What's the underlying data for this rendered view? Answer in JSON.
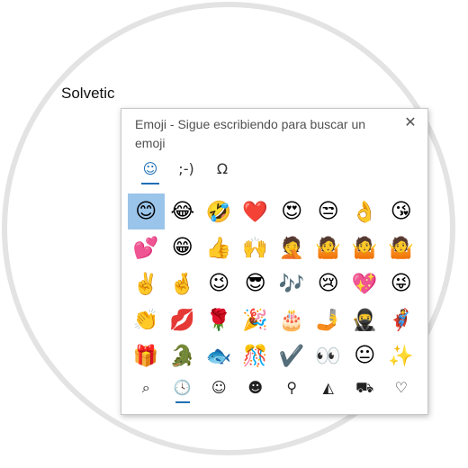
{
  "document": {
    "text": "Solvetic"
  },
  "emoji_panel": {
    "title": "Emoji - Sigue escribiendo para buscar un emoji",
    "close_glyph": "✕",
    "tabs": [
      {
        "name": "emoji-tab",
        "glyph": "☺",
        "active": true
      },
      {
        "name": "kaomoji-tab",
        "glyph": ";-)",
        "active": false
      },
      {
        "name": "symbols-tab",
        "glyph": "Ω",
        "active": false
      }
    ],
    "selected_index": 0,
    "emojis": [
      "😊",
      "😂",
      "🤣",
      "❤️",
      "😍",
      "😒",
      "👌",
      "😘",
      "💕",
      "😁",
      "👍",
      "🙌",
      "🤦",
      "🤷",
      "🤷",
      "🤷",
      "✌️",
      "🤞",
      "😉",
      "😎",
      "🎶",
      "😢",
      "💖",
      "😜",
      "👏",
      "💋",
      "🌹",
      "🎉",
      "🎂",
      "🤳",
      "🥷",
      "🦸",
      "🎁",
      "🐊",
      "🐟",
      "🎊",
      "✔️",
      "👀",
      "😐",
      "✨"
    ],
    "categories": [
      {
        "name": "search-icon",
        "glyph": "⌕",
        "active": false
      },
      {
        "name": "recent-clock-icon",
        "glyph": "🕓",
        "active": true
      },
      {
        "name": "smiley-icon",
        "glyph": "☺",
        "active": false
      },
      {
        "name": "people-icon",
        "glyph": "☻",
        "active": false
      },
      {
        "name": "balloon-icon",
        "glyph": "⚲",
        "active": false
      },
      {
        "name": "pizza-icon",
        "glyph": "◭",
        "active": false
      },
      {
        "name": "car-icon",
        "glyph": "⛟",
        "active": false
      },
      {
        "name": "heart-icon",
        "glyph": "♡",
        "active": false
      }
    ]
  }
}
